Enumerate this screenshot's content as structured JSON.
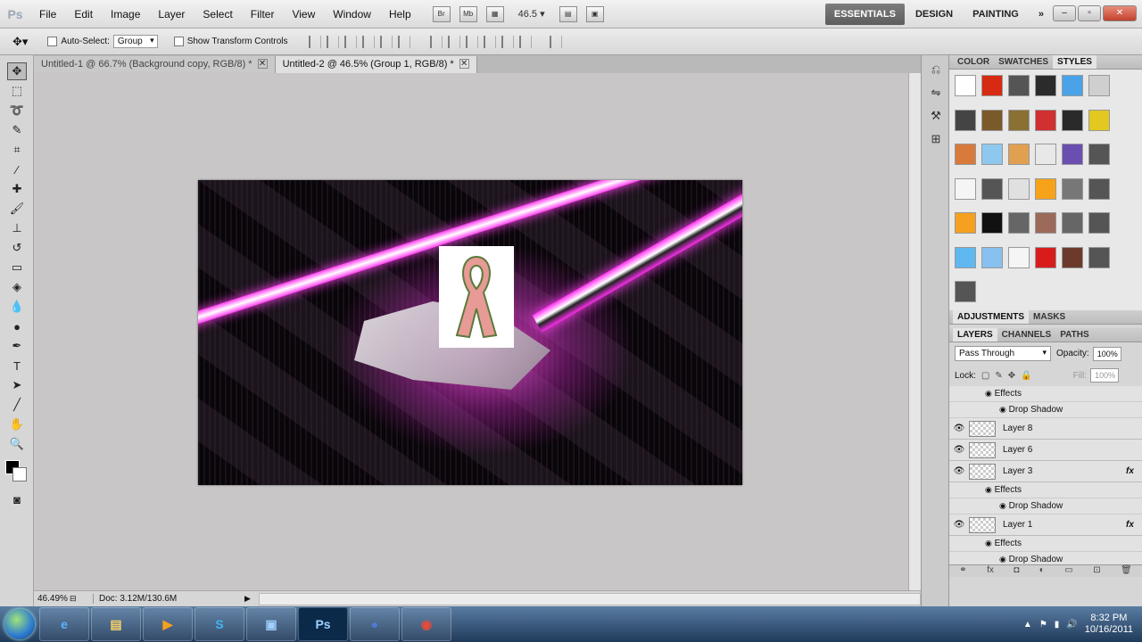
{
  "app": {
    "logo": "Ps"
  },
  "menu": [
    "File",
    "Edit",
    "Image",
    "Layer",
    "Select",
    "Filter",
    "View",
    "Window",
    "Help"
  ],
  "menubar_icons": [
    "Br",
    "Mb"
  ],
  "zoom_dropdown": "46.5",
  "workspaces": {
    "essentials": "ESSENTIALS",
    "design": "DESIGN",
    "painting": "PAINTING",
    "more": "»"
  },
  "options": {
    "auto_select_label": "Auto-Select:",
    "auto_select_value": "Group",
    "show_transform_label": "Show Transform Controls"
  },
  "tabs": [
    {
      "label": "Untitled-1 @ 66.7% (Background copy, RGB/8) *",
      "close": "✕"
    },
    {
      "label": "Untitled-2 @ 46.5% (Group 1, RGB/8) *",
      "close": "✕"
    }
  ],
  "status": {
    "zoom": "46.49%",
    "doc": "Doc: 3.12M/130.6M"
  },
  "panel_tabs": {
    "color": "COLOR",
    "swatches": "SWATCHES",
    "styles": "STYLES",
    "adjustments": "ADJUSTMENTS",
    "masks": "MASKS",
    "layers": "LAYERS",
    "channels": "CHANNELS",
    "paths": "PATHS"
  },
  "layers_panel": {
    "blend_mode": "Pass Through",
    "opacity_label": "Opacity:",
    "opacity_value": "100%",
    "lock_label": "Lock:",
    "fill_label": "Fill:",
    "fill_value": "100%",
    "effects_label": "Effects",
    "drop_shadow_label": "Drop Shadow",
    "layers": [
      {
        "name": "Layer 8",
        "fx": ""
      },
      {
        "name": "Layer 6",
        "fx": ""
      },
      {
        "name": "Layer 3",
        "fx": "fx"
      },
      {
        "name": "Layer 1",
        "fx": "fx"
      }
    ]
  },
  "style_swatches": [
    "#ffffff",
    "#d62a12",
    "#555555",
    "#2b2b2b",
    "#4aa3e8",
    "#cfcfcf",
    "#444444",
    "#7a5a2a",
    "#8a7033",
    "#d03030",
    "#2a2a2a",
    "#e3c820",
    "#d87a3a",
    "#8ec8ef",
    "#e0a050",
    "#e8e8e8",
    "#6a4fb0",
    "#555555",
    "#f5f5f5",
    "#555555",
    "#e0e0e0",
    "#f6a31a",
    "#777777",
    "#555555",
    "#f5a020",
    "#111111",
    "#666666",
    "#9b6a5a",
    "#666666",
    "#555555",
    "#5fb8f0",
    "#88c0ef",
    "#f5f5f5",
    "#d81c1c",
    "#6b3a2a",
    "#555555",
    "#555555"
  ],
  "clock": {
    "time": "8:32 PM",
    "date": "10/16/2011"
  },
  "taskbar_apps": [
    "ie",
    "explorer",
    "media",
    "skype",
    "network",
    "Ps",
    "firefox",
    "chrome"
  ]
}
